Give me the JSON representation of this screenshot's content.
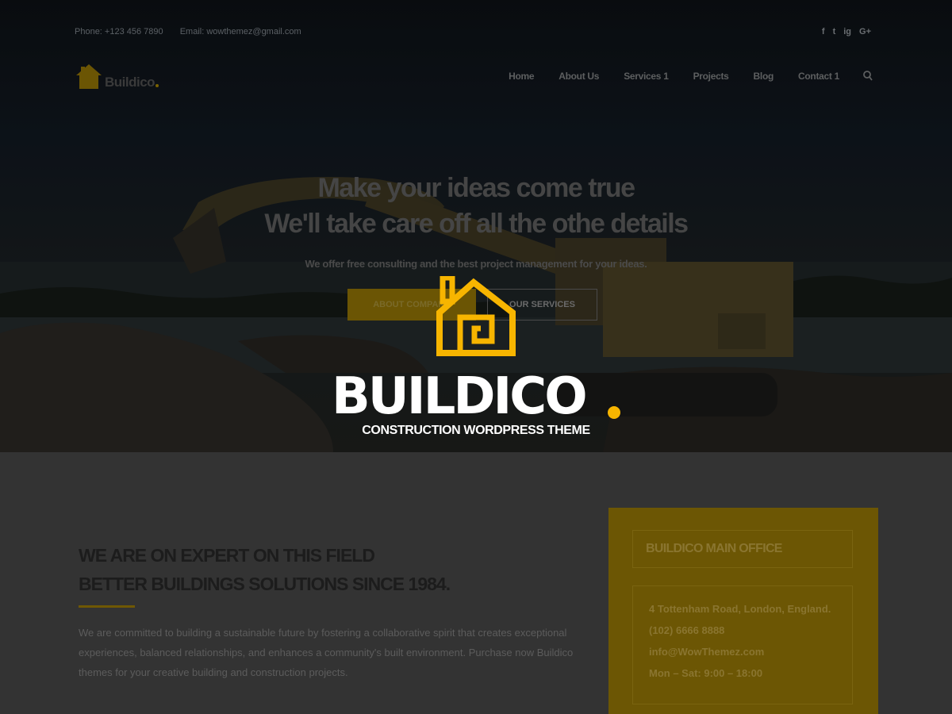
{
  "topbar": {
    "phone": "Phone: +123 456 7890",
    "email": "Email: wowthemez@gmail.com"
  },
  "social": [
    "f",
    "t",
    "ig",
    "G+"
  ],
  "logo": {
    "text": "Buildico"
  },
  "nav": {
    "items": [
      "Home",
      "About Us",
      "Services 1",
      "Projects",
      "Blog",
      "Contact 1"
    ]
  },
  "hero": {
    "title_line1": "Make your ideas come true",
    "title_line2": "We'll take care off all the othe details",
    "subtitle": "We offer free consulting and the best project management for your ideas.",
    "btn_primary": "ABOUT COMPANY",
    "btn_secondary": "OUR SERVICES"
  },
  "overlay": {
    "brand": "BUILDICO",
    "tagline": "CONSTRUCTION WORDPRESS THEME"
  },
  "about": {
    "title_line1": "WE ARE ON EXPERT ON THIS FIELD",
    "title_line2": "BETTER BUILDINGS SOLUTIONS SINCE 1984.",
    "text": "We are committed to building a sustainable future by fostering a collaborative spirit that creates exceptional experiences, balanced relationships, and enhances a community's built environment. Purchase now Buildico themes for your creative building and construction projects."
  },
  "office": {
    "title": "BUILDICO MAIN OFFICE",
    "address": "4 Tottenham Road, London, England.",
    "phone": "(102) 6666 8888",
    "email": "info@WowThemez.com",
    "hours": "Mon – Sat: 9:00 – 18:00"
  },
  "colors": {
    "accent": "#f7b500",
    "accent_dim": "#6c5604",
    "overlay_text": "#ffffff"
  }
}
